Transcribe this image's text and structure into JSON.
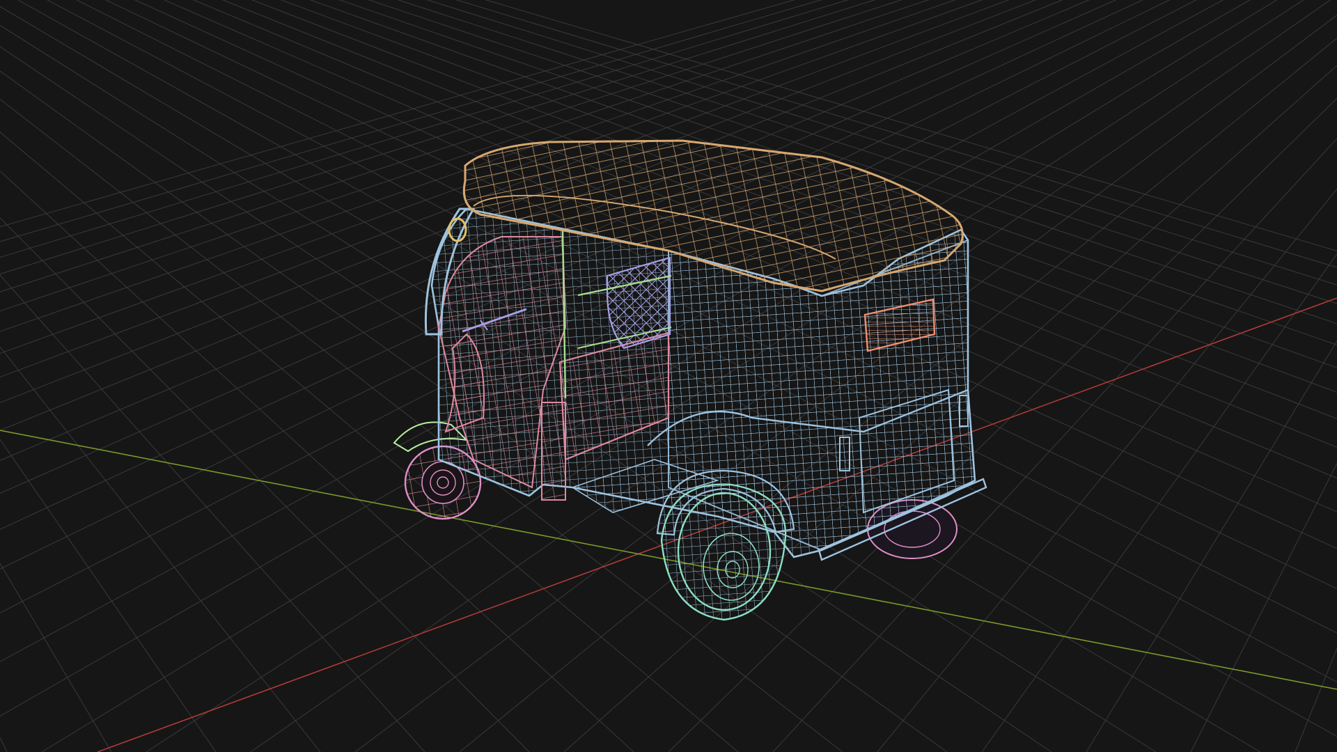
{
  "viewport": {
    "mode": "wireframe",
    "background_color": "#161616",
    "grid_color": "#3a3a3a",
    "x_axis_color": "#b03a3a",
    "y_axis_color": "#7a9a2a"
  },
  "scene": {
    "object": "auto-rickshaw",
    "parts": [
      {
        "name": "roof",
        "color": "#d8a870"
      },
      {
        "name": "body",
        "color": "#9ec4e0"
      },
      {
        "name": "interior",
        "color": "#e08aa0"
      },
      {
        "name": "front-wheel",
        "color": "#e090c8"
      },
      {
        "name": "rear-wheel-right",
        "color": "#8ee0c4"
      },
      {
        "name": "rear-wheel-left",
        "color": "#e090c8"
      },
      {
        "name": "seat",
        "color": "#a8a0e8"
      },
      {
        "name": "frame",
        "color": "#a8e090"
      },
      {
        "name": "mudguard",
        "color": "#b8f0a0"
      },
      {
        "name": "headlight",
        "color": "#e8c060"
      },
      {
        "name": "window",
        "color": "#f09070"
      }
    ]
  }
}
